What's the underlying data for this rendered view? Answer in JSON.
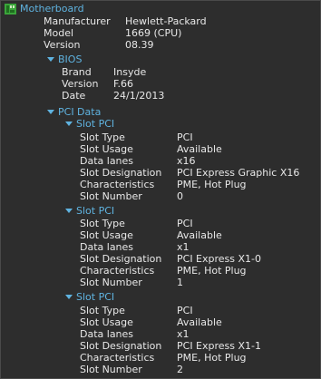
{
  "motherboard": {
    "title": "Motherboard",
    "fields": [
      {
        "key": "Manufacturer",
        "value": "Hewlett-Packard"
      },
      {
        "key": "Model",
        "value": "1669 (CPU)"
      },
      {
        "key": "Version",
        "value": "08.39"
      }
    ]
  },
  "bios": {
    "title": "BIOS",
    "fields": [
      {
        "key": "Brand",
        "value": "Insyde"
      },
      {
        "key": "Version",
        "value": "F.66"
      },
      {
        "key": "Date",
        "value": "24/1/2013"
      }
    ]
  },
  "pci": {
    "title": "PCI Data",
    "slots": [
      {
        "title": "Slot PCI",
        "fields": [
          {
            "key": "Slot Type",
            "value": "PCI"
          },
          {
            "key": "Slot Usage",
            "value": "Available"
          },
          {
            "key": "Data lanes",
            "value": "x16"
          },
          {
            "key": "Slot Designation",
            "value": "PCI Express Graphic X16"
          },
          {
            "key": "Characteristics",
            "value": "PME, Hot Plug"
          },
          {
            "key": "Slot Number",
            "value": "0"
          }
        ]
      },
      {
        "title": "Slot PCI",
        "fields": [
          {
            "key": "Slot Type",
            "value": "PCI"
          },
          {
            "key": "Slot Usage",
            "value": "Available"
          },
          {
            "key": "Data lanes",
            "value": "x1"
          },
          {
            "key": "Slot Designation",
            "value": "PCI Express X1-0"
          },
          {
            "key": "Characteristics",
            "value": "PME, Hot Plug"
          },
          {
            "key": "Slot Number",
            "value": "1"
          }
        ]
      },
      {
        "title": "Slot PCI",
        "fields": [
          {
            "key": "Slot Type",
            "value": "PCI"
          },
          {
            "key": "Slot Usage",
            "value": "Available"
          },
          {
            "key": "Data lanes",
            "value": "x1"
          },
          {
            "key": "Slot Designation",
            "value": "PCI Express X1-1"
          },
          {
            "key": "Characteristics",
            "value": "PME, Hot Plug"
          },
          {
            "key": "Slot Number",
            "value": "2"
          }
        ]
      }
    ]
  },
  "colors": {
    "heading": "#5fb3e0",
    "text": "#e8e8e8",
    "background": "#2d2d2d",
    "icon": "#3aa53a"
  }
}
